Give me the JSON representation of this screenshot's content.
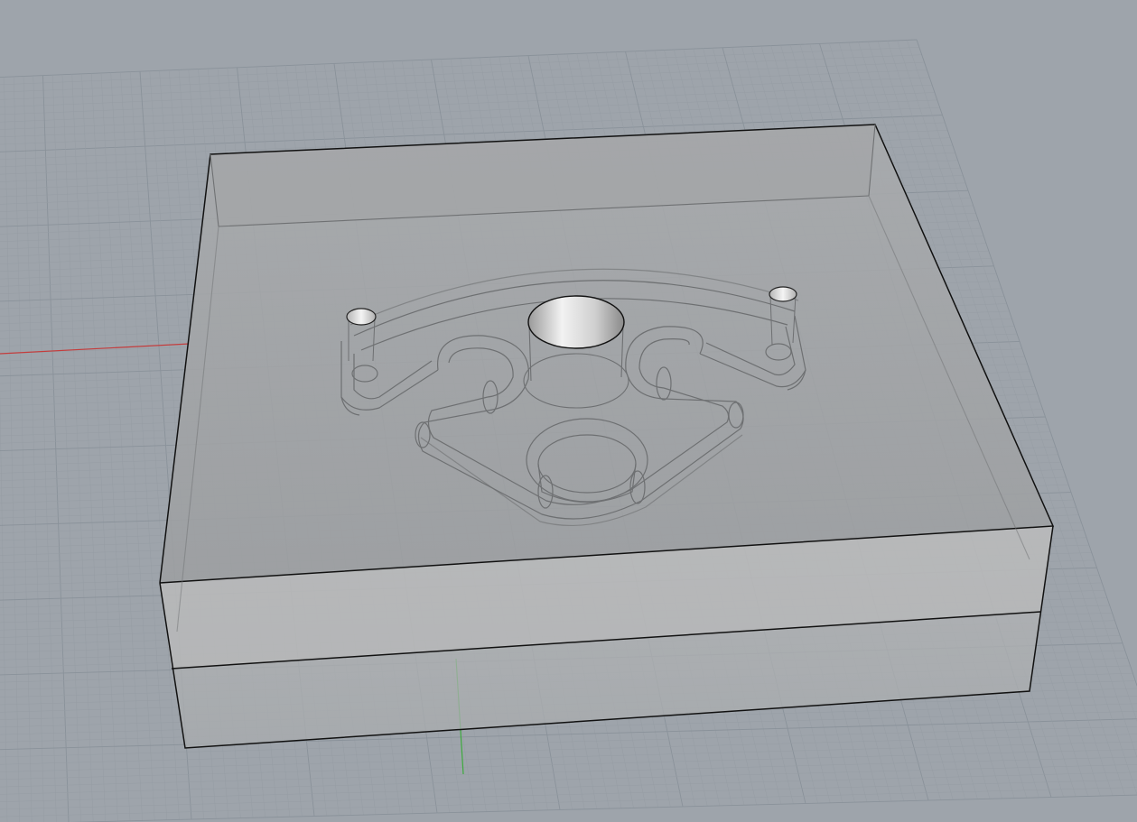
{
  "viewport": {
    "display_mode": "ghosted",
    "projection": "perspective",
    "background_color": "#9ea4ab",
    "grid_visible": true,
    "grid_major_color": "#8a929a",
    "grid_minor_color": "#969da4",
    "x_axis_color": "#c43c3c",
    "y_axis_color": "#3caa3c"
  },
  "scene": {
    "objects": [
      {
        "name": "mold-block",
        "kind": "box",
        "color": "#c4c4c4"
      },
      {
        "name": "mold-cavity",
        "kind": "channel",
        "color": "#b0b0b0"
      },
      {
        "name": "sprue-cylinder",
        "kind": "cylinder",
        "color": "#d8d8d8"
      },
      {
        "name": "vent-pin-left",
        "kind": "cylinder",
        "color": "#e6e6e6"
      },
      {
        "name": "vent-pin-right",
        "kind": "cylinder",
        "color": "#e6e6e6"
      }
    ]
  }
}
